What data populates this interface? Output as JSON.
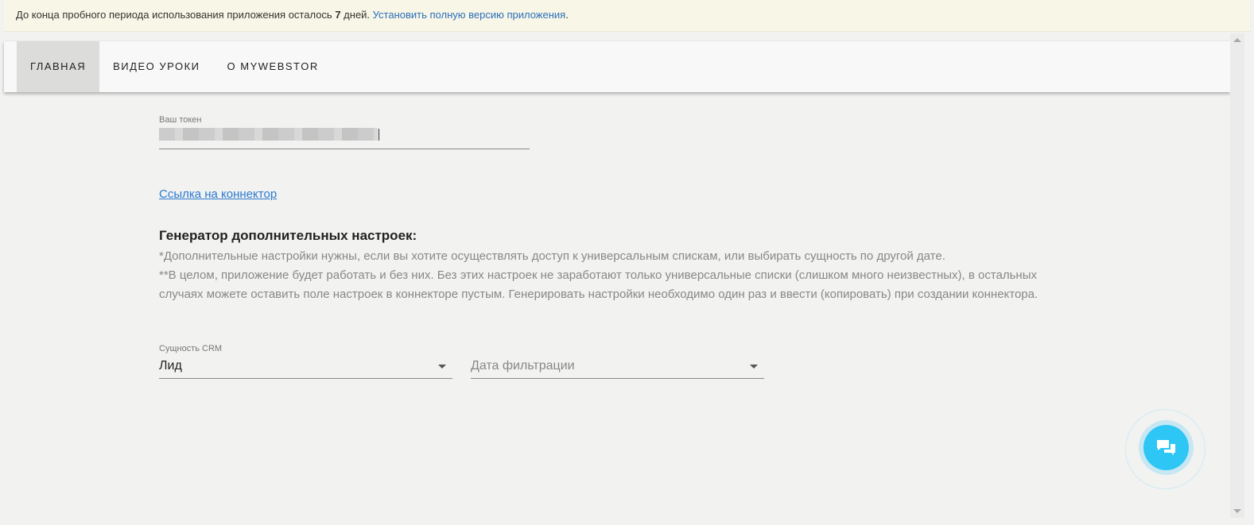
{
  "notice": {
    "text_before": "До конца пробного периода использования приложения осталось ",
    "days": "7",
    "text_after": " дней. ",
    "link": "Установить полную версию приложения",
    "period": "."
  },
  "nav": {
    "tabs": [
      {
        "label": "ГЛАВНАЯ"
      },
      {
        "label": "ВИДЕО УРОКИ"
      },
      {
        "label": "О MYWEBSTOR"
      }
    ]
  },
  "token": {
    "label": "Ваш токен"
  },
  "connector_link": "Ссылка на коннектор",
  "generator": {
    "title": "Генератор дополнительных настроек:",
    "line1": "*Дополнительные настройки нужны, если вы хотите осуществлять доступ к универсальным спискам, или выбирать сущность по другой дате.",
    "line2": "**В целом, приложение будет работать и без них. Без этих настроек не заработают только универсальные списки (слишком много неизвестных), в остальных случаях можете оставить поле настроек в коннекторе пустым. Генерировать настройки необходимо один раз и ввести (копировать) при создании коннектора."
  },
  "entity": {
    "label": "Сущность CRM",
    "value": "Лид"
  },
  "date_filter": {
    "placeholder": "Дата фильтрации"
  }
}
